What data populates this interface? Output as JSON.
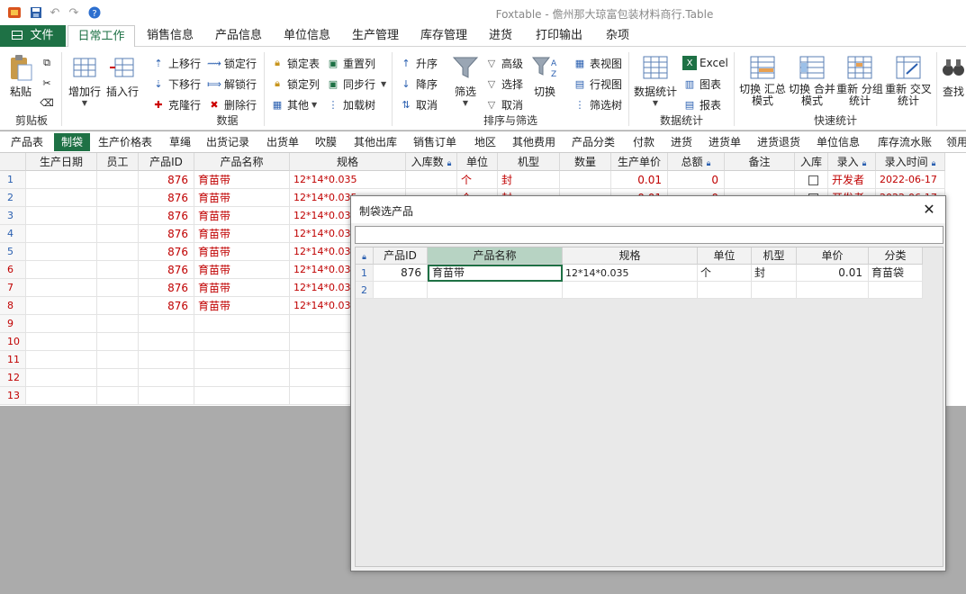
{
  "window": {
    "title": "Foxtable - 儋州那大琼富包装材料商行.Table"
  },
  "ribbon_tabs": [
    "文件",
    "日常工作",
    "销售信息",
    "产品信息",
    "单位信息",
    "生产管理",
    "库存管理",
    "进货",
    "打印输出",
    "杂项"
  ],
  "ribbon": {
    "clipboard": {
      "paste": "粘贴",
      "label": "剪贴板"
    },
    "data": {
      "add_row": "增加行",
      "insert_row": "插入行",
      "move_up": "上移行",
      "move_down": "下移行",
      "clone_row": "克隆行",
      "lock_row": "锁定行",
      "unlock_row": "解锁行",
      "delete_row": "删除行",
      "lock_table": "锁定表",
      "lock_col": "锁定列",
      "other": "其他",
      "reset_col": "重置列",
      "sync_row": "同步行",
      "load_tree": "加载树",
      "label": "数据"
    },
    "sort": {
      "asc": "升序",
      "desc": "降序",
      "cancel_sort": "取消",
      "filter": "筛选",
      "advanced": "高级",
      "select": "选择",
      "cancel_filter": "取消",
      "switch": "切换",
      "table_view": "表视图",
      "row_view": "行视图",
      "filter_tree": "筛选树",
      "label": "排序与筛选"
    },
    "stats": {
      "data_stats": "数据统计",
      "excel": "Excel",
      "chart": "图表",
      "report": "报表",
      "label": "数据统计"
    },
    "quick": {
      "switch_summary": "切换 汇总模式",
      "switch_merge": "切换 合并模式",
      "regroup": "重新 分组统计",
      "recross": "重新 交叉统计",
      "find": "查找",
      "label": "快速统计"
    }
  },
  "sheet_tabs": [
    "产品表",
    "制袋",
    "生产价格表",
    "草绳",
    "出货记录",
    "出货单",
    "吹膜",
    "其他出库",
    "销售订单",
    "地区",
    "其他费用",
    "产品分类",
    "付款",
    "进货",
    "进货单",
    "进货退货",
    "单位信息",
    "库存流水账",
    "领用"
  ],
  "main_table": {
    "columns": [
      "生产日期",
      "员工",
      "产品ID",
      "产品名称",
      "规格",
      "入库数",
      "单位",
      "机型",
      "数量",
      "生产单价",
      "总额",
      "备注",
      "入库",
      "录入",
      "录入时间"
    ],
    "row_numbers": [
      "1",
      "2",
      "3",
      "4",
      "5",
      "6",
      "7",
      "8",
      "9",
      "10",
      "11",
      "12",
      "13"
    ],
    "rows": [
      {
        "id": "876",
        "name": "育苗带",
        "spec": "12*14*0.035",
        "unit": "个",
        "model": "封",
        "price": "0.01",
        "total": "0",
        "by": "开发者",
        "time": "2022-06-17"
      },
      {
        "id": "876",
        "name": "育苗带",
        "spec": "12*14*0.035",
        "unit": "个",
        "model": "封",
        "price": "0.01",
        "total": "0",
        "by": "开发者",
        "time": "2022-06-17"
      },
      {
        "id": "876",
        "name": "育苗带",
        "spec": "12*14*0.035"
      },
      {
        "id": "876",
        "name": "育苗带",
        "spec": "12*14*0.035"
      },
      {
        "id": "876",
        "name": "育苗带",
        "spec": "12*14*0.035"
      },
      {
        "id": "876",
        "name": "育苗带",
        "spec": "12*14*0.035"
      },
      {
        "id": "876",
        "name": "育苗带",
        "spec": "12*14*0.035"
      },
      {
        "id": "876",
        "name": "育苗带",
        "spec": "12*14*0.035"
      }
    ]
  },
  "dialog": {
    "title": "制袋选产品",
    "search_value": "",
    "columns": [
      "产品ID",
      "产品名称",
      "规格",
      "单位",
      "机型",
      "单价",
      "分类"
    ],
    "row_numbers": [
      "1",
      "2"
    ],
    "rows": [
      {
        "id": "876",
        "name": "育苗带",
        "spec": "12*14*0.035",
        "unit": "个",
        "model": "封",
        "price": "0.01",
        "category": "育苗袋"
      }
    ]
  },
  "colors": {
    "accent": "#1e7145",
    "data_red": "#c00000",
    "row_number_blue": "#2a5fb0"
  }
}
